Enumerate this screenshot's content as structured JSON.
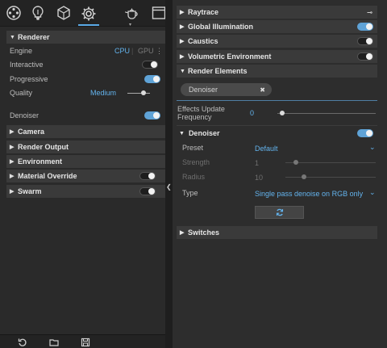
{
  "toolbar": {
    "icons": [
      "render-settings-icon",
      "lighting-icon",
      "material-box-icon",
      "gear-icon",
      "teapot-icon",
      "window-icon"
    ],
    "dropdown_glyph": "▾"
  },
  "left": {
    "renderer": {
      "title": "Renderer",
      "engine_label": "Engine",
      "engine_cpu": "CPU",
      "engine_gpu": "GPU",
      "interactive_label": "Interactive",
      "interactive_on": false,
      "progressive_label": "Progressive",
      "progressive_on": true,
      "quality_label": "Quality",
      "quality_value": "Medium"
    },
    "denoiser_label": "Denoiser",
    "denoiser_on": true,
    "sections": [
      {
        "label": "Camera"
      },
      {
        "label": "Render Output"
      },
      {
        "label": "Environment"
      },
      {
        "label": "Material Override",
        "toggle": false
      },
      {
        "label": "Swarm",
        "toggle": false
      }
    ]
  },
  "right": {
    "sections_top": [
      {
        "label": "Raytrace"
      },
      {
        "label": "Global Illumination",
        "toggle": true
      },
      {
        "label": "Caustics",
        "toggle": false
      },
      {
        "label": "Volumetric Environment",
        "toggle": false
      }
    ],
    "render_elements": {
      "title": "Render Elements",
      "chip_label": "Denoiser",
      "chip_close": "✖"
    },
    "effects_update_label": "Effects Update Frequency",
    "effects_update_value": "0",
    "denoiser": {
      "title": "Denoiser",
      "toggle_on": true,
      "preset_label": "Preset",
      "preset_value": "Default",
      "strength_label": "Strength",
      "strength_value": "1",
      "radius_label": "Radius",
      "radius_value": "10",
      "type_label": "Type",
      "type_value": "Single pass denoise on RGB only"
    },
    "switches_title": "Switches"
  }
}
